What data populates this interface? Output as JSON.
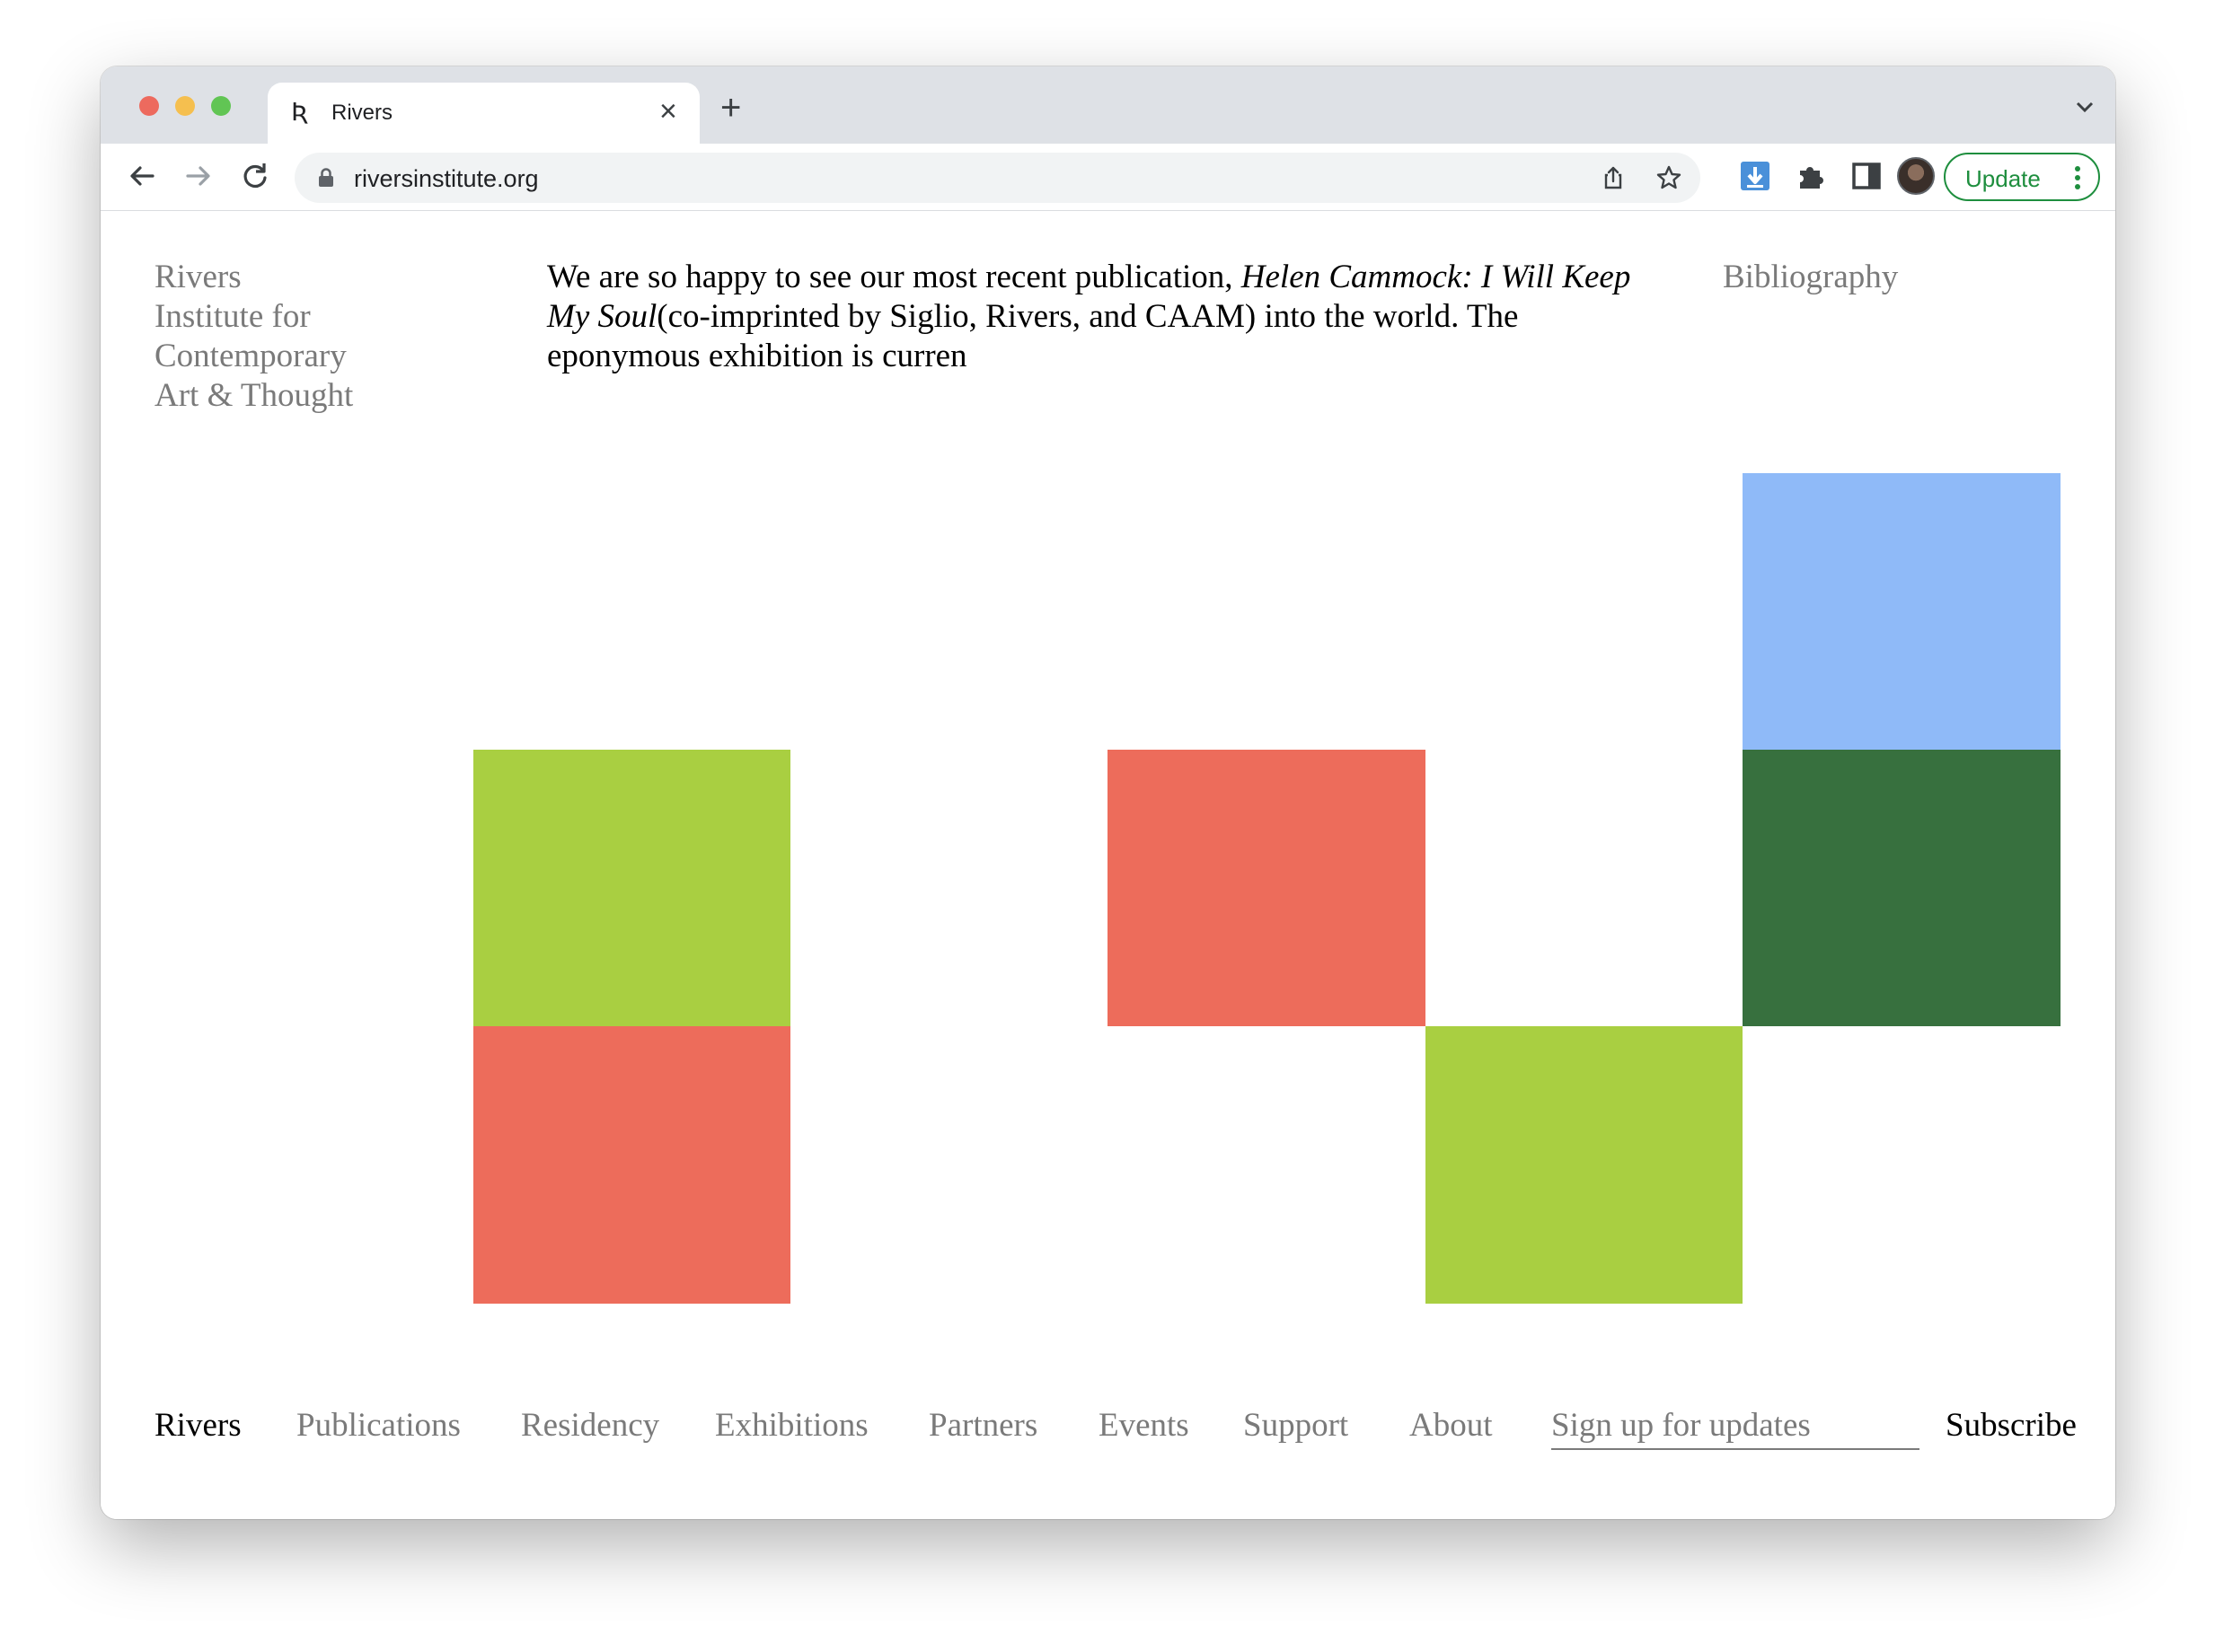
{
  "browser": {
    "tab_favicon": "Ʀ",
    "tab_title": "Rivers",
    "tab_close": "×",
    "new_tab": "+",
    "url": "riversinstitute.org",
    "update_label": "Update",
    "icons": [
      "back-icon",
      "forward-icon",
      "reload-icon",
      "lock-icon",
      "share-icon",
      "star-icon",
      "download-extension-icon",
      "puzzle-extension-icon",
      "side-panel-icon",
      "profile-avatar",
      "more-icon",
      "tab-list-chevron-icon"
    ]
  },
  "site": {
    "logo": "Rivers\nInstitute for\nContemporary\nArt & Thought",
    "intro": {
      "before": "We are so happy to see our most recent publication, ",
      "italic": "Helen Cammock: I Will Keep My Soul",
      "after": "(co-imprinted by Siglio, Rivers, and CAAM) into the world. The eponymous exhibition is curren"
    },
    "bibliography": "Bibliography"
  },
  "colors": {
    "lime": "#a9cf41",
    "coral": "#ed6c5b",
    "sky": "#8fbaf8",
    "forest": "#37703e",
    "grey_text": "#7a7a7a"
  },
  "blocks": [
    {
      "name": "block-lime-1",
      "color": "lime"
    },
    {
      "name": "block-coral-1",
      "color": "coral"
    },
    {
      "name": "block-coral-2",
      "color": "coral"
    },
    {
      "name": "block-lime-2",
      "color": "lime"
    },
    {
      "name": "block-sky",
      "color": "sky"
    },
    {
      "name": "block-forest",
      "color": "forest"
    }
  ],
  "nav": {
    "items": [
      "Rivers",
      "Publications",
      "Residency",
      "Exhibitions",
      "Partners",
      "Events",
      "Support",
      "About"
    ],
    "active": "Rivers",
    "signup_placeholder": "Sign up for updates",
    "subscribe": "Subscribe"
  }
}
